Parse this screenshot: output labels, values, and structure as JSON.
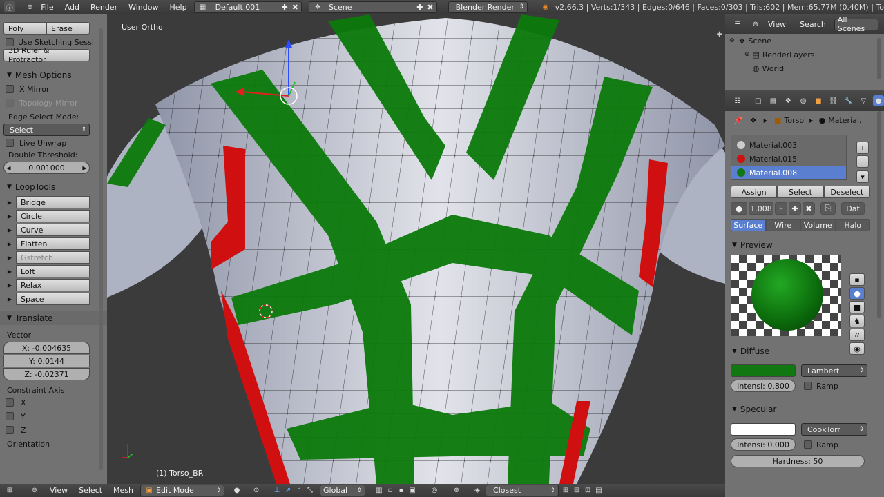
{
  "topbar": {
    "menus": [
      "File",
      "Add",
      "Render",
      "Window",
      "Help"
    ],
    "screen_layout": "Default.001",
    "scene": "Scene",
    "engine": "Blender Render",
    "stats": "v2.66.3 | Verts:1/343 | Edges:0/646 | Faces:0/303 | Tris:602 | Mem:65.77M (0.40M) | To"
  },
  "left_panel": {
    "grease_buttons": [
      "Poly",
      "Erase"
    ],
    "sketching": "Use Sketching Sessi",
    "ruler": "3D Ruler & Protractor",
    "mesh_options_title": "Mesh Options",
    "x_mirror": "X Mirror",
    "topology_mirror": "Topology Mirror",
    "edge_select_mode_label": "Edge Select Mode:",
    "edge_select_mode_value": "Select",
    "live_unwrap": "Live Unwrap",
    "double_threshold_label": "Double Threshold:",
    "double_threshold_value": "0.001000",
    "looptools_title": "LoopTools",
    "looptools": [
      "Bridge",
      "Circle",
      "Curve",
      "Flatten",
      "Gstretch",
      "Loft",
      "Relax",
      "Space"
    ],
    "translate_title": "Translate",
    "vector_label": "Vector",
    "vector_x": "X: -0.004635",
    "vector_y": "Y: 0.0144",
    "vector_z": "Z: -0.02371",
    "constraint_axis_label": "Constraint Axis",
    "axes": [
      "X",
      "Y",
      "Z"
    ],
    "orientation_label": "Orientation"
  },
  "viewport": {
    "view_label": "User Ortho",
    "object_label": "(1) Torso_BR"
  },
  "outliner": {
    "menu_view": "View",
    "menu_search": "Search",
    "filter": "All Scenes",
    "items": [
      "Scene",
      "RenderLayers",
      "World"
    ]
  },
  "properties": {
    "breadcrumb_object": "Torso",
    "breadcrumb_material": "Material.",
    "materials": [
      {
        "name": "Material.003",
        "color": "#cccccc"
      },
      {
        "name": "Material.015",
        "color": "#cc1111"
      },
      {
        "name": "Material.008",
        "color": "#117711"
      }
    ],
    "assign": "Assign",
    "select": "Select",
    "deselect": "Deselect",
    "material_field": "1.008",
    "fake_user": "F",
    "data_label": "Dat",
    "tabs": [
      "Surface",
      "Wire",
      "Volume",
      "Halo"
    ],
    "preview_title": "Preview",
    "diffuse_title": "Diffuse",
    "diffuse_color": "#117711",
    "diffuse_shader": "Lambert",
    "diffuse_intensity": "Intensi: 0.800",
    "ramp": "Ramp",
    "specular_title": "Specular",
    "specular_shader": "CookTorr",
    "specular_intensity": "Intensi: 0.000",
    "hardness": "Hardness: 50"
  },
  "bottombar": {
    "menus": [
      "View",
      "Select",
      "Mesh"
    ],
    "mode": "Edit Mode",
    "orientation": "Global",
    "snap": "Closest"
  }
}
